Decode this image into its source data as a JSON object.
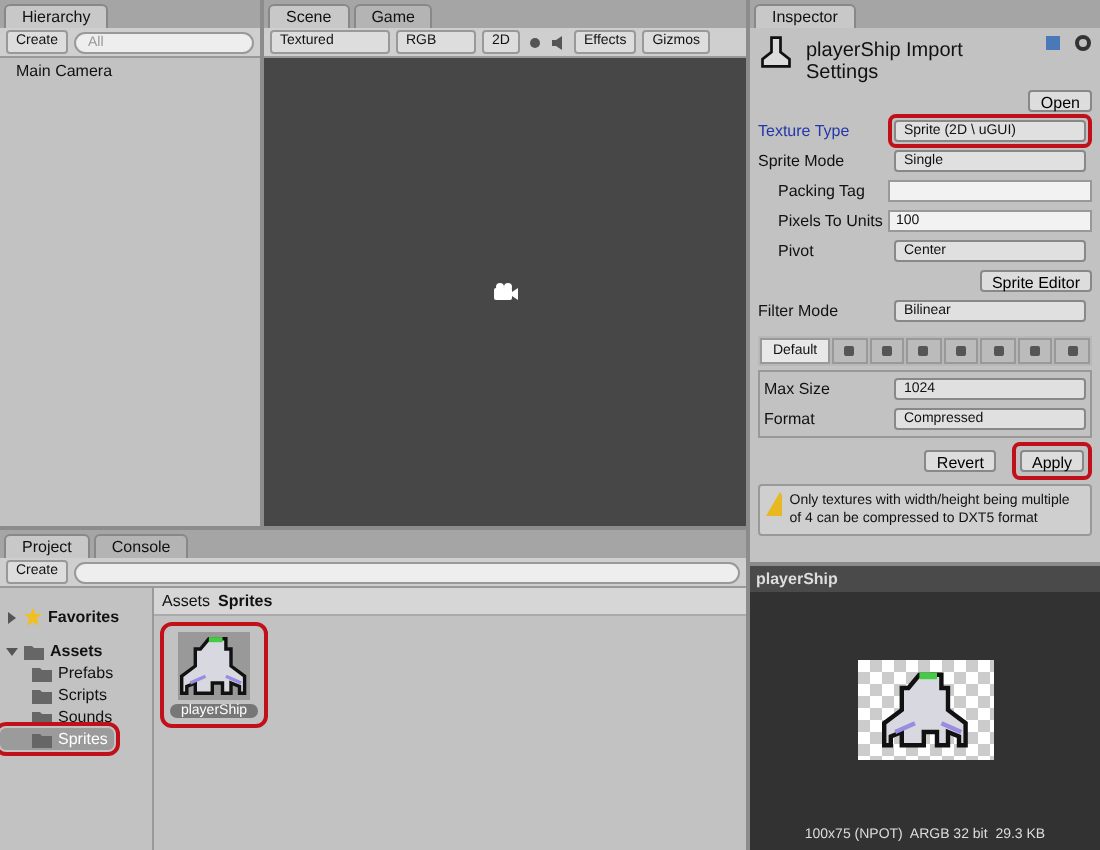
{
  "hierarchy": {
    "title": "Hierarchy",
    "create": "Create",
    "search_placeholder": "All",
    "items": [
      {
        "label": "Main Camera",
        "selected": false
      }
    ]
  },
  "scene": {
    "tabs": [
      {
        "label": "Scene",
        "selected": true
      },
      {
        "label": "Game",
        "selected": false
      }
    ],
    "shading": "Textured",
    "channel": "RGB",
    "mode_2d": "2D",
    "effects": "Effects",
    "gizmos": "Gizmos"
  },
  "inspector": {
    "title": "Inspector",
    "asset_title": "playerShip Import Settings",
    "open": "Open",
    "fields": [
      {
        "kind": "dropdown",
        "label": "Texture Type",
        "value": "Sprite (2D \\ uGUI)",
        "highlighted": true
      },
      {
        "kind": "dropdown",
        "label": "Sprite Mode",
        "value": "Single",
        "highlighted": false,
        "children": [
          {
            "kind": "text",
            "label": "Packing Tag",
            "highlighted": false
          },
          {
            "kind": "text",
            "label": "Pixels To Units",
            "value": "100",
            "highlighted": false
          },
          {
            "kind": "dropdown",
            "label": "Pivot",
            "value": "Center",
            "highlighted": false
          }
        ]
      },
      {
        "kind": "button",
        "label": "Sprite Editor",
        "highlighted": false
      },
      {
        "kind": "dropdown",
        "label": "Filter Mode",
        "value": "Bilinear",
        "highlighted": false
      }
    ],
    "platform_tabs": [
      {
        "label": "Default",
        "selected": true
      },
      {
        "selected": false
      },
      {
        "selected": false
      },
      {
        "selected": false
      },
      {
        "selected": false
      },
      {
        "selected": false
      },
      {
        "selected": false
      },
      {
        "selected": false
      }
    ],
    "platform_fields": [
      {
        "label": "Max Size",
        "value": "1024"
      },
      {
        "label": "Format",
        "value": "Compressed"
      }
    ],
    "buttons": [
      {
        "label": "Revert",
        "highlighted": false
      },
      {
        "label": "Apply",
        "highlighted": true
      }
    ],
    "warning": "Only textures with width/height being multiple of 4 can be compressed to DXT5 format"
  },
  "project": {
    "tabs": [
      {
        "label": "Project",
        "selected": true
      },
      {
        "label": "Console",
        "selected": false
      }
    ],
    "create": "Create",
    "tree": [
      {
        "label": "Favorites",
        "kind": "favorites",
        "expanded": false
      },
      {
        "label": "Assets",
        "kind": "folder",
        "expanded": true,
        "children": [
          {
            "label": "Prefabs",
            "selected": false,
            "highlighted": false
          },
          {
            "label": "Scripts",
            "selected": false,
            "highlighted": false
          },
          {
            "label": "Sounds",
            "selected": false,
            "highlighted": false
          },
          {
            "label": "Sprites",
            "selected": true,
            "highlighted": true
          }
        ]
      }
    ],
    "breadcrumb": [
      "Assets",
      "Sprites"
    ],
    "assets": [
      {
        "label": "playerShip",
        "highlighted": true
      }
    ]
  },
  "preview": {
    "title": "playerShip",
    "info": "100x75 (NPOT)  ARGB 32 bit  29.3 KB"
  }
}
